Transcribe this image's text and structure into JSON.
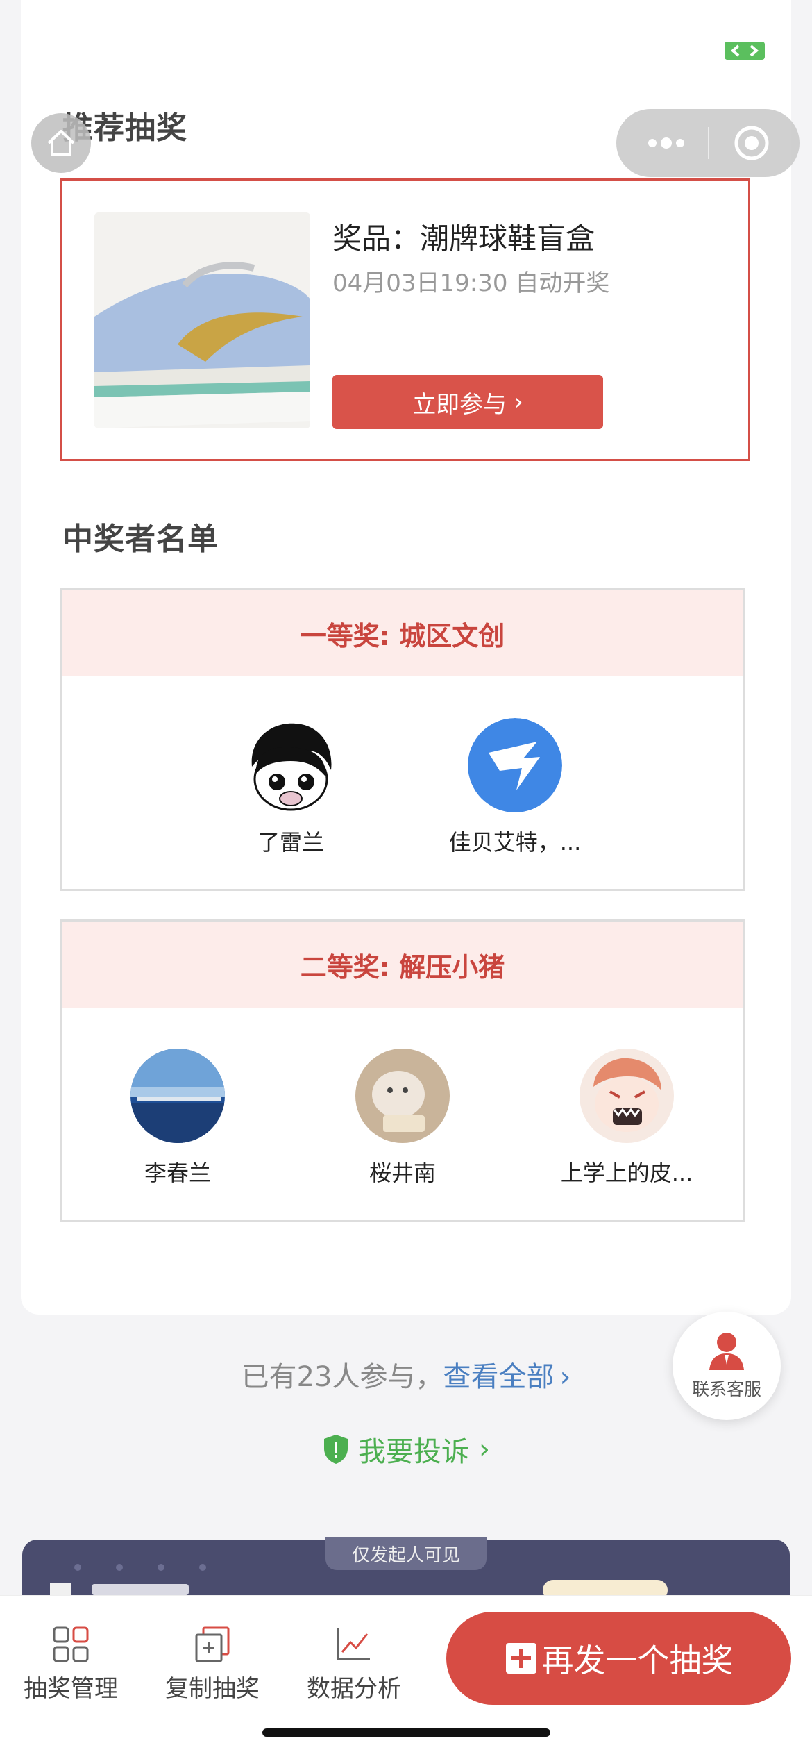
{
  "recommend": {
    "title": "推荐抽奖",
    "prize": "奖品：潮牌球鞋盲盒",
    "time": "04月03日19:30 自动开奖",
    "join_button": "立即参与",
    "chevron": "›"
  },
  "winners": {
    "title": "中奖者名单",
    "first_prize": {
      "label": "一等奖: 城区文创",
      "people": [
        {
          "name": "了雷兰"
        },
        {
          "name": "佳贝艾特，..."
        }
      ]
    },
    "second_prize": {
      "label": "二等奖: 解压小猪",
      "people": [
        {
          "name": "李春兰"
        },
        {
          "name": "桜井南"
        },
        {
          "name": "上学上的皮..."
        }
      ]
    }
  },
  "footer": {
    "participants_text": "已有23人参与，",
    "view_all": "查看全部",
    "chevron": "›",
    "complain": "我要投诉"
  },
  "service": {
    "label": "联系客服"
  },
  "banner": {
    "tag": "仅发起人可见"
  },
  "bottom_bar": {
    "tabs": [
      {
        "label": "抽奖管理",
        "icon": "grid-icon"
      },
      {
        "label": "复制抽奖",
        "icon": "copy-add-icon"
      },
      {
        "label": "数据分析",
        "icon": "line-chart-icon"
      }
    ],
    "primary_button": "再发一个抽奖"
  },
  "colors": {
    "accent_red": "#d9534a",
    "link_blue": "#4a7fc1",
    "green": "#4caf50"
  }
}
